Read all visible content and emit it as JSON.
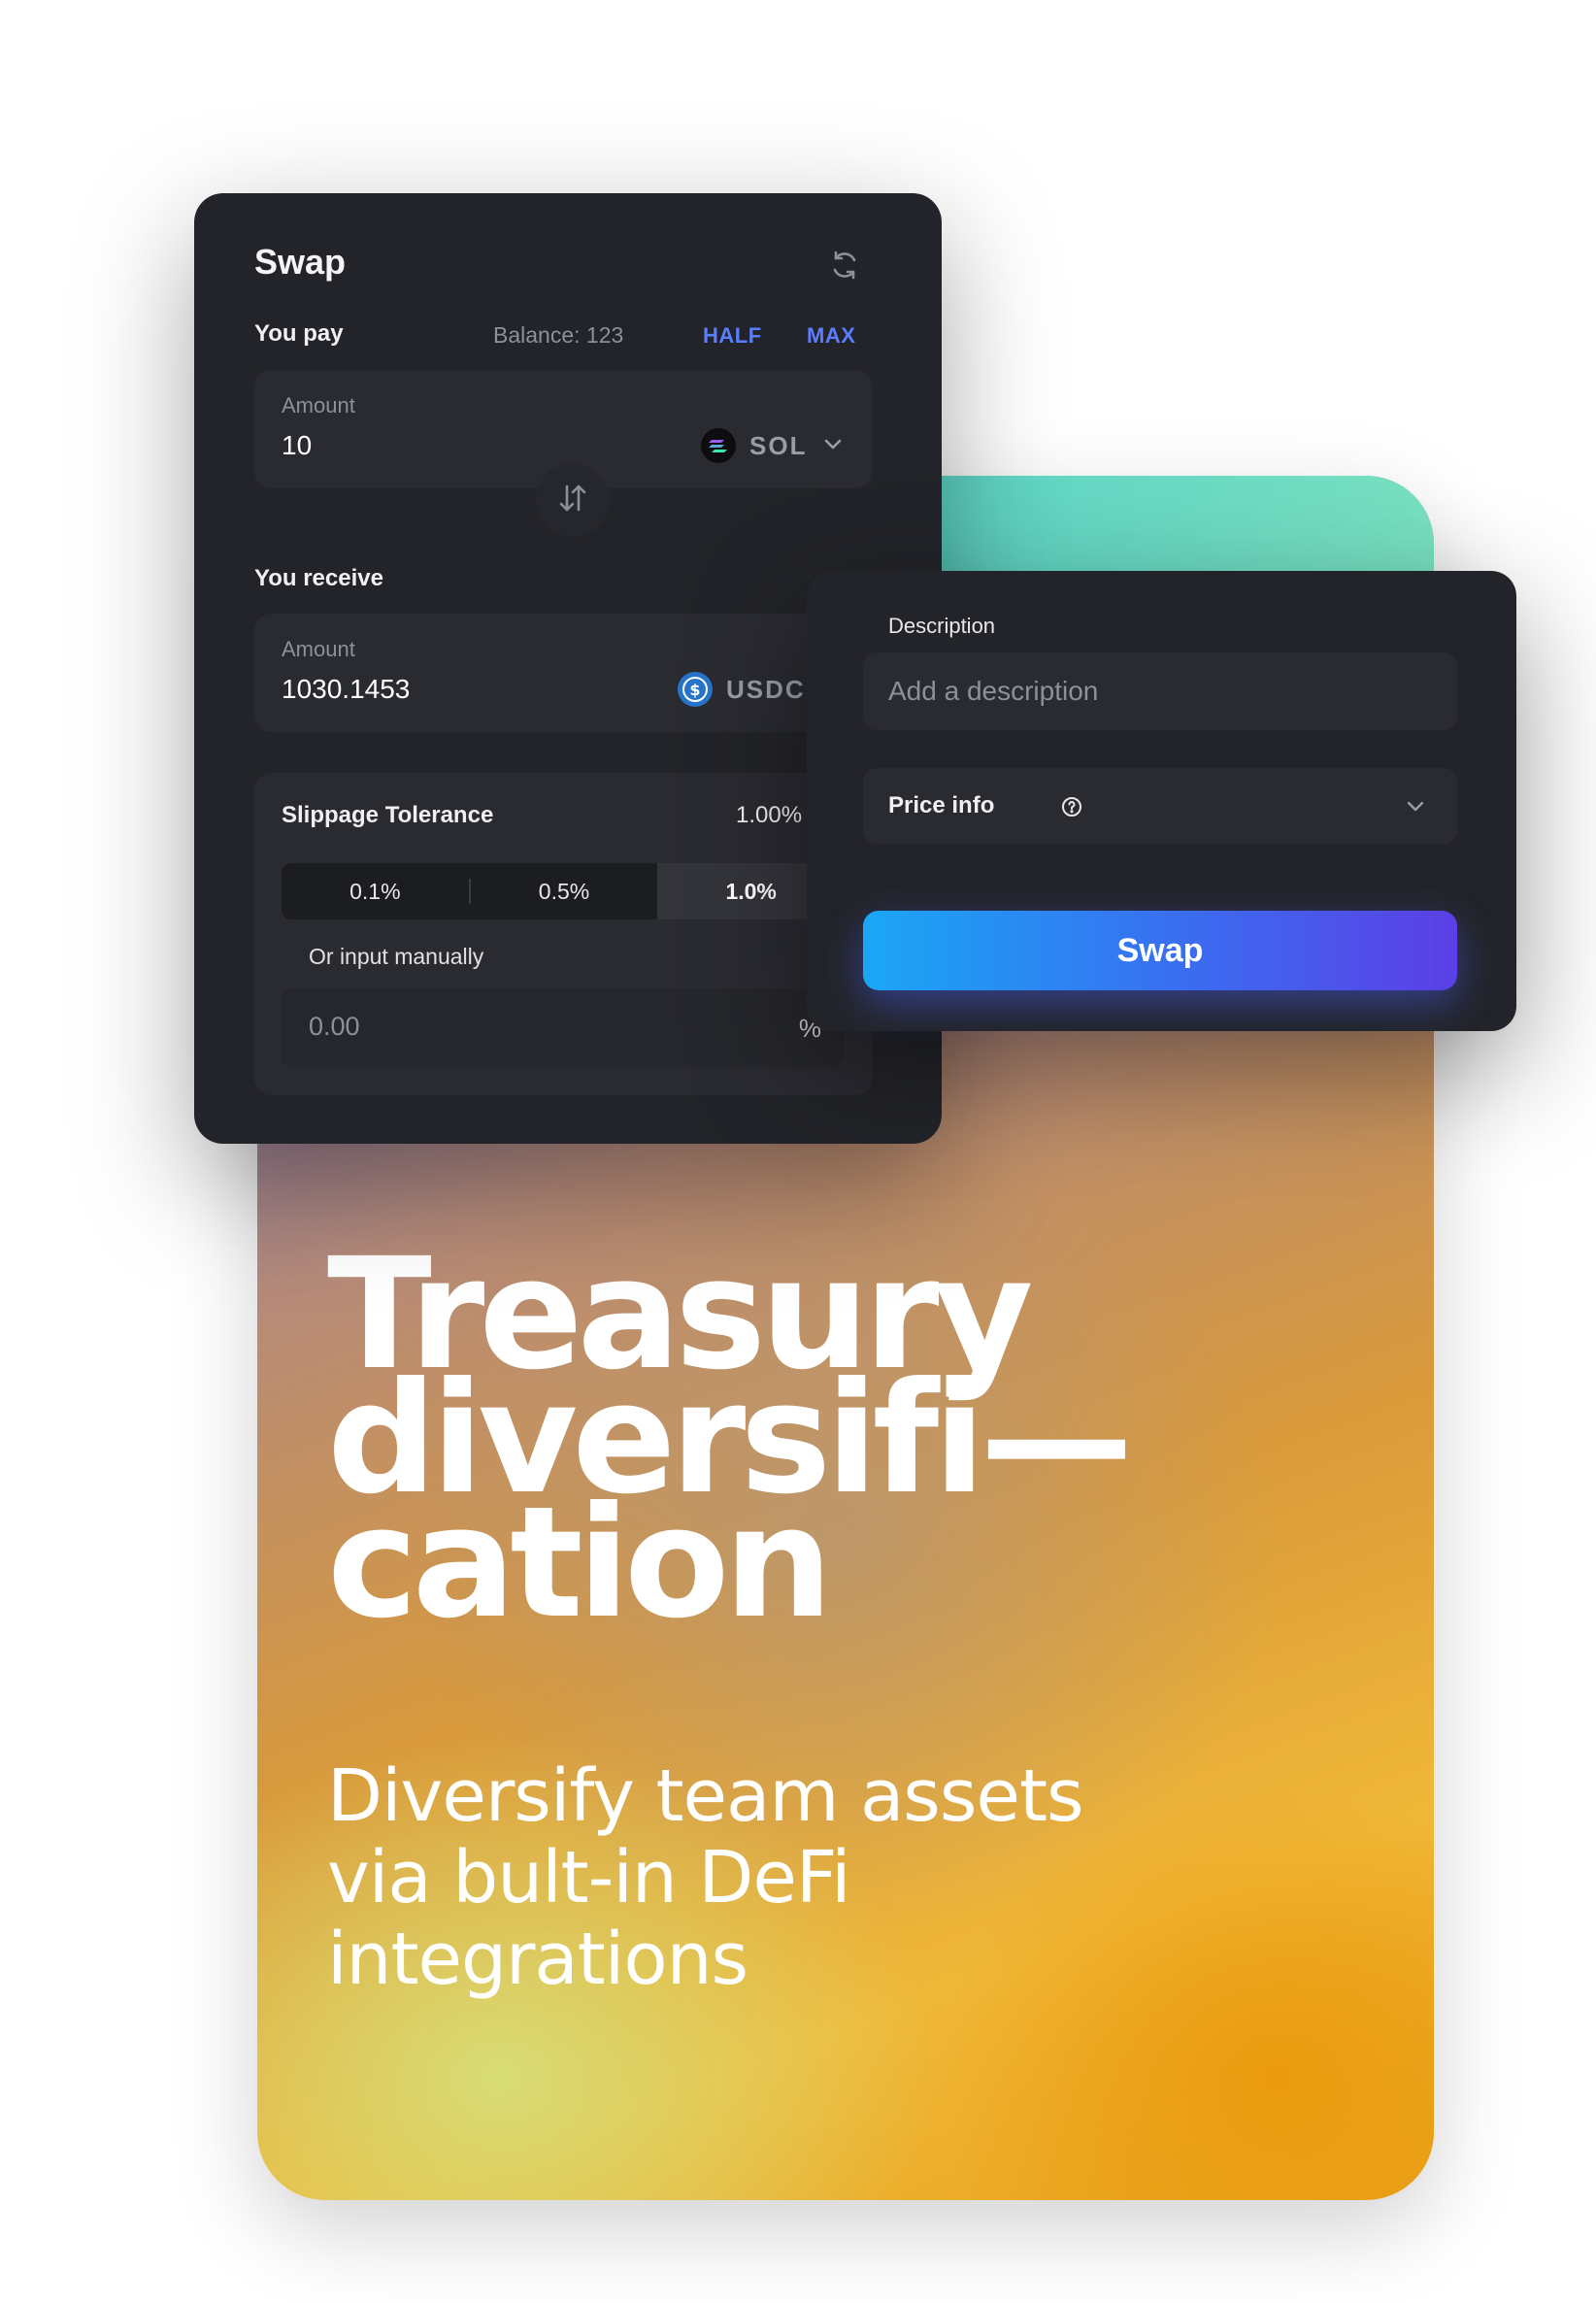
{
  "hero": {
    "headline": [
      "Treasury",
      "diversifi—",
      "cation"
    ],
    "subhead": [
      "Diversify team assets",
      "via bult-in DeFi",
      "integrations"
    ]
  },
  "swap": {
    "title": "Swap",
    "refresh_icon": "refresh-icon",
    "you_pay_label": "You pay",
    "balance": "Balance: 123",
    "half_label": "HALF",
    "max_label": "MAX",
    "pay_field": {
      "label": "Amount",
      "value": "10",
      "token": "SOL",
      "token_icon": "solana-icon"
    },
    "flip_icon": "swap-arrows-icon",
    "you_receive_label": "You receive",
    "receive_field": {
      "label": "Amount",
      "value": "1030.1453",
      "token": "USDC",
      "token_icon": "usdc-icon"
    },
    "slippage": {
      "title": "Slippage Tolerance",
      "current": "1.00%",
      "options": [
        "0.1%",
        "0.5%",
        "1.0%"
      ],
      "selected_index": 2,
      "manual_label": "Or input manually",
      "manual_placeholder": "0.00",
      "unit": "%"
    }
  },
  "description": {
    "label": "Description",
    "placeholder": "Add a description",
    "price_info_label": "Price info",
    "swap_button": "Swap"
  },
  "colors": {
    "panel_bg": "#232429",
    "field_bg": "#2a2b31",
    "accent_link": "#5b7dff",
    "button_start": "#1aa7f5",
    "button_end": "#5b3fe6"
  }
}
